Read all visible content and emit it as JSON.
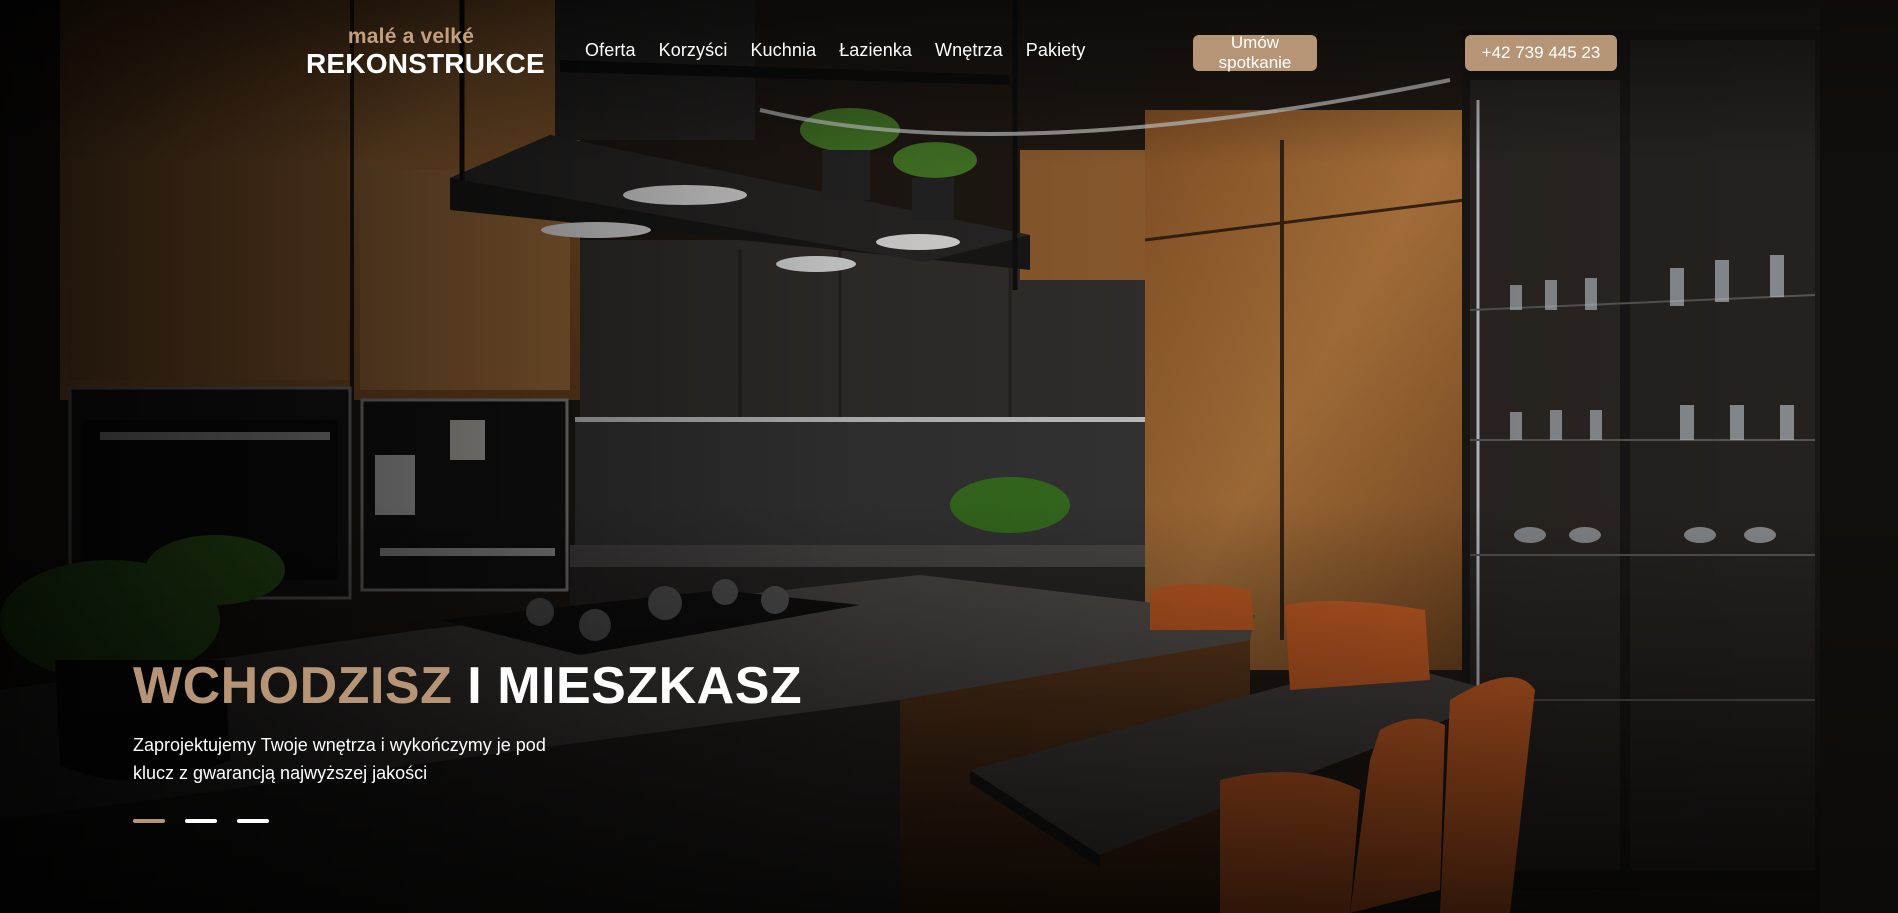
{
  "logo": {
    "top_text": "malé a velké",
    "bottom_text": "REKONSTRUKCE"
  },
  "nav": {
    "items": [
      {
        "label": "Oferta"
      },
      {
        "label": "Korzyści"
      },
      {
        "label": "Kuchnia"
      },
      {
        "label": "Łazienka"
      },
      {
        "label": "Wnętrza"
      },
      {
        "label": "Pakiety"
      }
    ]
  },
  "header": {
    "meeting_button": "Umów spotkanie",
    "phone_button": "+42 739 445 23"
  },
  "hero": {
    "title_accent": "WCHODZISZ",
    "title_rest": "I MIESZKASZ",
    "subtitle": "Zaprojektujemy Twoje wnętrza i wykończymy je pod klucz z gwarancją najwyższej jakości",
    "background_image": "modern kitchen interior with wooden cabinets, black island with gas hob, orange chairs and glass display cabinet",
    "slides_total": 3,
    "active_slide": 1
  },
  "colors": {
    "accent": "#b69576",
    "text": "#ffffff"
  }
}
